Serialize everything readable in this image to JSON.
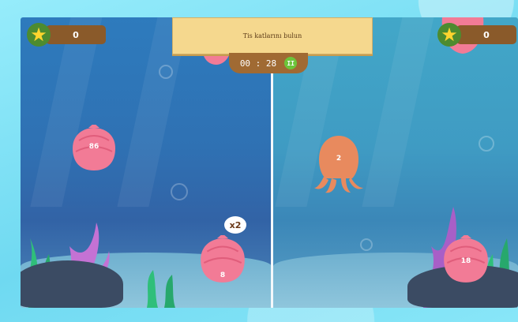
{
  "game": {
    "instruction": "Tis katlarını bulun",
    "timer": "00 : 28",
    "pause_icon": "pause-icon"
  },
  "players": [
    {
      "score": "0",
      "icon": "star-icon"
    },
    {
      "score": "0",
      "icon": "star-icon"
    }
  ],
  "creatures": {
    "left": [
      {
        "kind": "shell",
        "number": "86"
      },
      {
        "kind": "shell",
        "number": "8",
        "multiplier": "x2"
      }
    ],
    "right": [
      {
        "kind": "octopus",
        "number": "2"
      },
      {
        "kind": "shell",
        "number": "18"
      }
    ]
  },
  "colors": {
    "shell": "#f27b96",
    "octopus": "#e88a5e",
    "score_box": "#8a5a2a",
    "banner": "#f5d88e",
    "star": "#ffd52e"
  }
}
